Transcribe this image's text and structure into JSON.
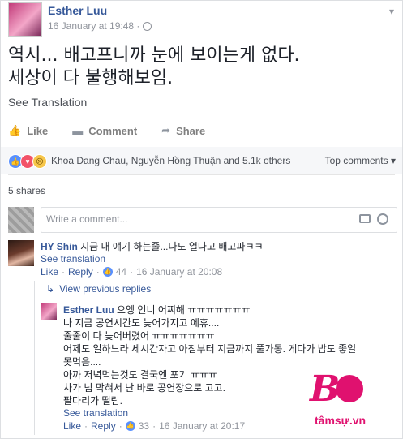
{
  "post": {
    "author": "Esther Luu",
    "timestamp": "16 January at 19:48 ·",
    "text_line1": "역시... 배고프니까 눈에 보이는게 없다.",
    "text_line2": "세상이 다 불행해보임.",
    "see_translation": "See Translation"
  },
  "actions": {
    "like": "Like",
    "comment": "Comment",
    "share": "Share"
  },
  "reactions": {
    "summary": "Khoa Dang Chau, Nguyễn Hồng Thuận and 5.1k others",
    "top_comments": "Top comments ▾"
  },
  "shares": "5 shares",
  "comment_box": {
    "placeholder": "Write a comment..."
  },
  "comments": [
    {
      "name": "HY Shin",
      "text": "지금 내 얘기 하는줄...나도 열나고 배고파ㅋㅋ",
      "see_translation": "See translation",
      "like": "Like",
      "reply": "Reply",
      "likes": "44",
      "time": "16 January at 20:08"
    }
  ],
  "view_previous": "View previous replies",
  "reply": {
    "name": "Esther Luu",
    "lines": [
      "으엥 언니 어찌해 ㅠㅠㅠㅠㅠㅠㅠ",
      "나 지금 공연시간도 늦어가지고 에휴....",
      "줄줄이 다 늦어버렸어 ㅠㅠㅠㅠㅠㅠㅠ",
      "어제도 일하느라 세시간자고 아침부터 지금까지 풀가동. 게다가 밥도 좋일",
      "못먹음....",
      "아까 저녁먹는것도 결국엔 포기 ㅠㅠㅠ",
      "차가 넘 막혀서 난 바로 공연장으로 고고.",
      "팔다리가 떨림."
    ],
    "see_translation": "See translation",
    "like": "Like",
    "reply": "Reply",
    "likes": "33",
    "time": "16 January at 20:17"
  },
  "watermark": {
    "text": "tâmsự.vn"
  }
}
